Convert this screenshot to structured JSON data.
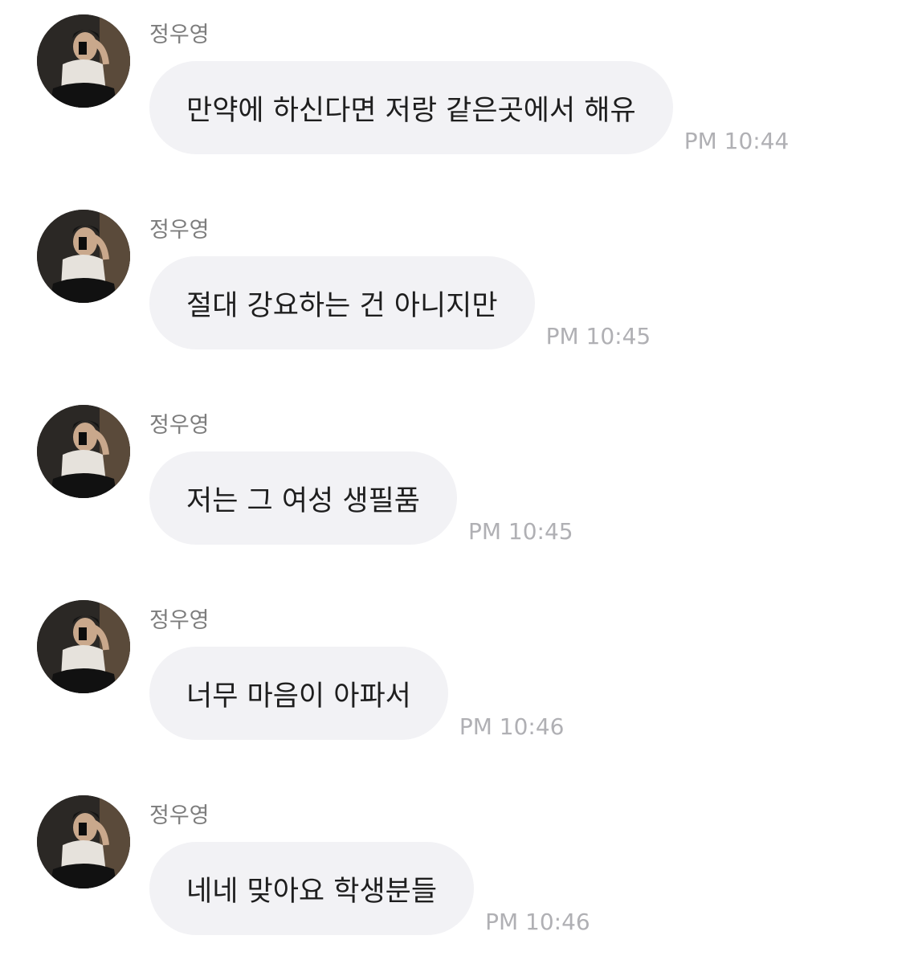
{
  "colors": {
    "bubble": "#f2f2f5",
    "sender": "#7d7d7d",
    "time": "#b0b0b4",
    "text": "#1e1e1e"
  },
  "avatar_icon": "profile-photo-avatar",
  "messages": [
    {
      "sender": "정우영",
      "text": "만약에 하신다면 저랑 같은곳에서 해유",
      "time": "PM 10:44"
    },
    {
      "sender": "정우영",
      "text": "절대 강요하는 건 아니지만",
      "time": "PM 10:45"
    },
    {
      "sender": "정우영",
      "text": "저는 그 여성 생필품",
      "time": "PM 10:45"
    },
    {
      "sender": "정우영",
      "text": "너무 마음이 아파서",
      "time": "PM 10:46"
    },
    {
      "sender": "정우영",
      "text": "네네 맞아요 학생분들",
      "time": "PM 10:46"
    }
  ]
}
